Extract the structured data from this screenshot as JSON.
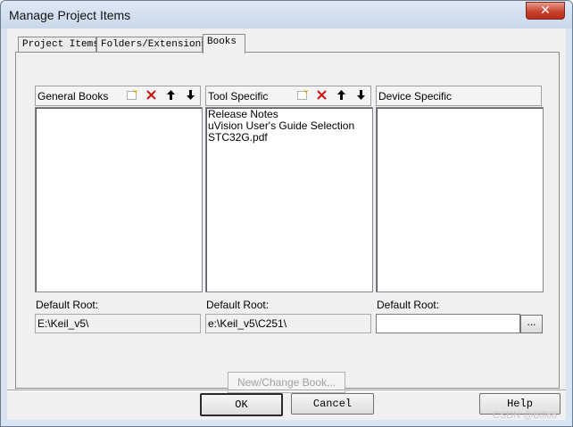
{
  "window": {
    "title": "Manage Project Items",
    "close_label": "✕"
  },
  "tabs": [
    {
      "label": "Project Items"
    },
    {
      "label": "Folders/Extensions"
    },
    {
      "label": "Books"
    }
  ],
  "groups": {
    "general": {
      "title": "General Books",
      "items": [],
      "root_label": "Default Root:",
      "root_value": "E:\\Keil_v5\\"
    },
    "tool": {
      "title": "Tool Specific",
      "items": [
        "Release Notes",
        "uVision User's Guide Selection",
        "STC32G.pdf"
      ],
      "root_label": "Default Root:",
      "root_value": "e:\\Keil_v5\\C251\\"
    },
    "device": {
      "title": "Device Specific",
      "items": [],
      "root_label": "Default Root:",
      "root_value": "",
      "browse_label": "..."
    }
  },
  "toolbar_icons": [
    "new-icon",
    "delete-icon",
    "move-up-icon",
    "move-down-icon"
  ],
  "buttons": {
    "new_change": "New/Change Book...",
    "ok": "OK",
    "cancel": "Cancel",
    "help": "Help"
  },
  "watermark": "CSDN @Bill66",
  "colors": {
    "title_bar": "#c9d8ea",
    "close_button": "#c7432d",
    "dialog_bg": "#f0f0f0",
    "delete_icon": "#d01010"
  }
}
